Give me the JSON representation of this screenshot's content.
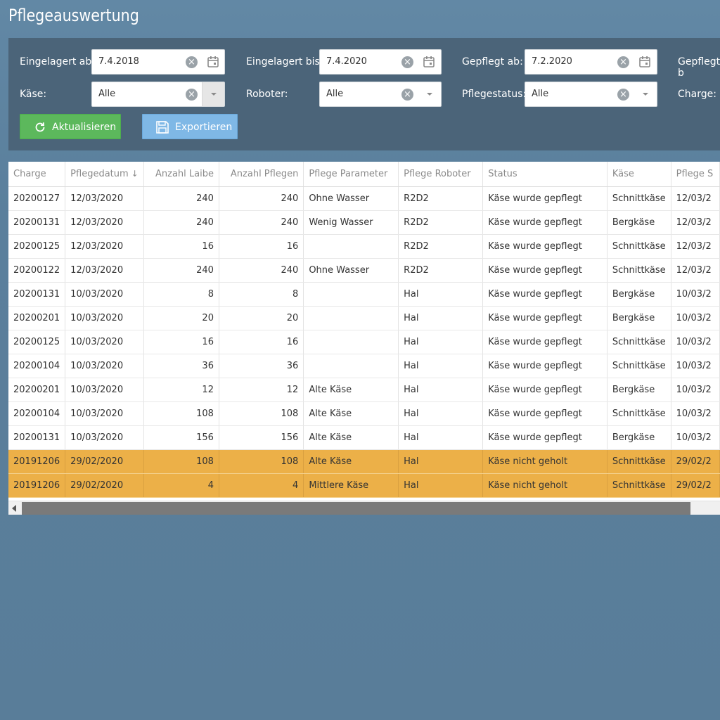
{
  "page": {
    "title": "Pflegeauswertung"
  },
  "filters": {
    "eingelagert_ab": {
      "label": "Eingelagert ab:",
      "value": "7.4.2018"
    },
    "eingelagert_bis": {
      "label": "Eingelagert bis:",
      "value": "7.4.2020"
    },
    "gepflegt_ab": {
      "label": "Gepflegt ab:",
      "value": "7.2.2020"
    },
    "gepflegt_bis": {
      "label": "Gepflegt b"
    },
    "kaese": {
      "label": "Käse:",
      "value": "Alle"
    },
    "roboter": {
      "label": "Roboter:",
      "value": "Alle"
    },
    "pflegestatus": {
      "label": "Pflegestatus:",
      "value": "Alle"
    },
    "charge": {
      "label": "Charge:"
    }
  },
  "buttons": {
    "refresh": "Aktualisieren",
    "export": "Exportieren"
  },
  "icons": {
    "refresh": "refresh-icon",
    "export": "save-icon",
    "clear": "clear-icon",
    "calendar": "calendar-icon",
    "dropdown": "chevron-down-icon"
  },
  "colors": {
    "refresh_button": "#5cb85c",
    "export_button": "#7fb8e6",
    "warning_row": "#ecb048"
  },
  "table": {
    "columns": [
      "Charge",
      "Pflegedatum",
      "Anzahl Laibe",
      "Anzahl Pflegen",
      "Pflege Parameter",
      "Pflege Roboter",
      "Status",
      "Käse",
      "Pflege S"
    ],
    "sort_indicator": "↓",
    "rows": [
      [
        "20200127",
        "12/03/2020",
        "240",
        "240",
        "Ohne Wasser",
        "R2D2",
        "Käse wurde gepflegt",
        "Schnittkäse",
        "12/03/2"
      ],
      [
        "20200131",
        "12/03/2020",
        "240",
        "240",
        "Wenig Wasser",
        "R2D2",
        "Käse wurde gepflegt",
        "Bergkäse",
        "12/03/2"
      ],
      [
        "20200125",
        "12/03/2020",
        "16",
        "16",
        "",
        "R2D2",
        "Käse wurde gepflegt",
        "Schnittkäse",
        "12/03/2"
      ],
      [
        "20200122",
        "12/03/2020",
        "240",
        "240",
        "Ohne Wasser",
        "R2D2",
        "Käse wurde gepflegt",
        "Schnittkäse",
        "12/03/2"
      ],
      [
        "20200131",
        "10/03/2020",
        "8",
        "8",
        "",
        "Hal",
        "Käse wurde gepflegt",
        "Bergkäse",
        "10/03/2"
      ],
      [
        "20200201",
        "10/03/2020",
        "20",
        "20",
        "",
        "Hal",
        "Käse wurde gepflegt",
        "Bergkäse",
        "10/03/2"
      ],
      [
        "20200125",
        "10/03/2020",
        "16",
        "16",
        "",
        "Hal",
        "Käse wurde gepflegt",
        "Schnittkäse",
        "10/03/2"
      ],
      [
        "20200104",
        "10/03/2020",
        "36",
        "36",
        "",
        "Hal",
        "Käse wurde gepflegt",
        "Schnittkäse",
        "10/03/2"
      ],
      [
        "20200201",
        "10/03/2020",
        "12",
        "12",
        "Alte Käse",
        "Hal",
        "Käse wurde gepflegt",
        "Bergkäse",
        "10/03/2"
      ],
      [
        "20200104",
        "10/03/2020",
        "108",
        "108",
        "Alte Käse",
        "Hal",
        "Käse wurde gepflegt",
        "Schnittkäse",
        "10/03/2"
      ],
      [
        "20200131",
        "10/03/2020",
        "156",
        "156",
        "Alte Käse",
        "Hal",
        "Käse wurde gepflegt",
        "Bergkäse",
        "10/03/2"
      ],
      [
        "20191206",
        "29/02/2020",
        "108",
        "108",
        "Alte Käse",
        "Hal",
        "Käse nicht geholt",
        "Schnittkäse",
        "29/02/2"
      ],
      [
        "20191206",
        "29/02/2020",
        "4",
        "4",
        "Mittlere Käse",
        "Hal",
        "Käse nicht geholt",
        "Schnittkäse",
        "29/02/2"
      ]
    ],
    "warning_status": "Käse nicht geholt"
  }
}
